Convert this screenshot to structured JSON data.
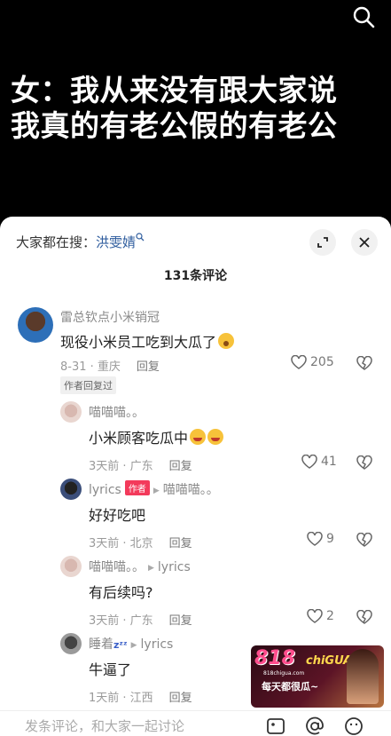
{
  "video": {
    "caption_line1": "女：我从来没有跟大家说",
    "caption_line2": "我真的有老公假的有老公"
  },
  "sheet": {
    "trending_prefix": "大家都在搜：",
    "trending_keyword": "洪雯婧",
    "comment_count": "131条评论"
  },
  "comments": [
    {
      "name": "雷总钦点小米销冠",
      "text": "现役小米员工吃到大瓜了",
      "date": "8-31 · 重庆",
      "reply": "回复",
      "likes": "205",
      "badge": "作者回复过"
    },
    {
      "name": "喵喵喵。。",
      "text": "小米顾客吃瓜中",
      "date": "3天前 · 广东",
      "reply": "回复",
      "likes": "41"
    },
    {
      "name": "lyrics",
      "author_tag": "作者",
      "reply_to": "喵喵喵。。",
      "text": "好好吃吧",
      "date": "3天前 · 北京",
      "reply": "回复",
      "likes": "9"
    },
    {
      "name": "喵喵喵。。",
      "reply_to": "lyrics",
      "text": "有后续吗?",
      "date": "3天前 · 广东",
      "reply": "回复",
      "likes": "2"
    },
    {
      "name": "睡着",
      "reply_to": "lyrics",
      "text": "牛逼了",
      "date": "1天前 · 江西",
      "reply": "回复"
    }
  ],
  "input": {
    "placeholder": "发条评论，和大家一起讨论"
  },
  "ad": {
    "number": "818",
    "brand": "chiGUA",
    "site": "818chigua.com",
    "slogan": "每天都很瓜~"
  }
}
